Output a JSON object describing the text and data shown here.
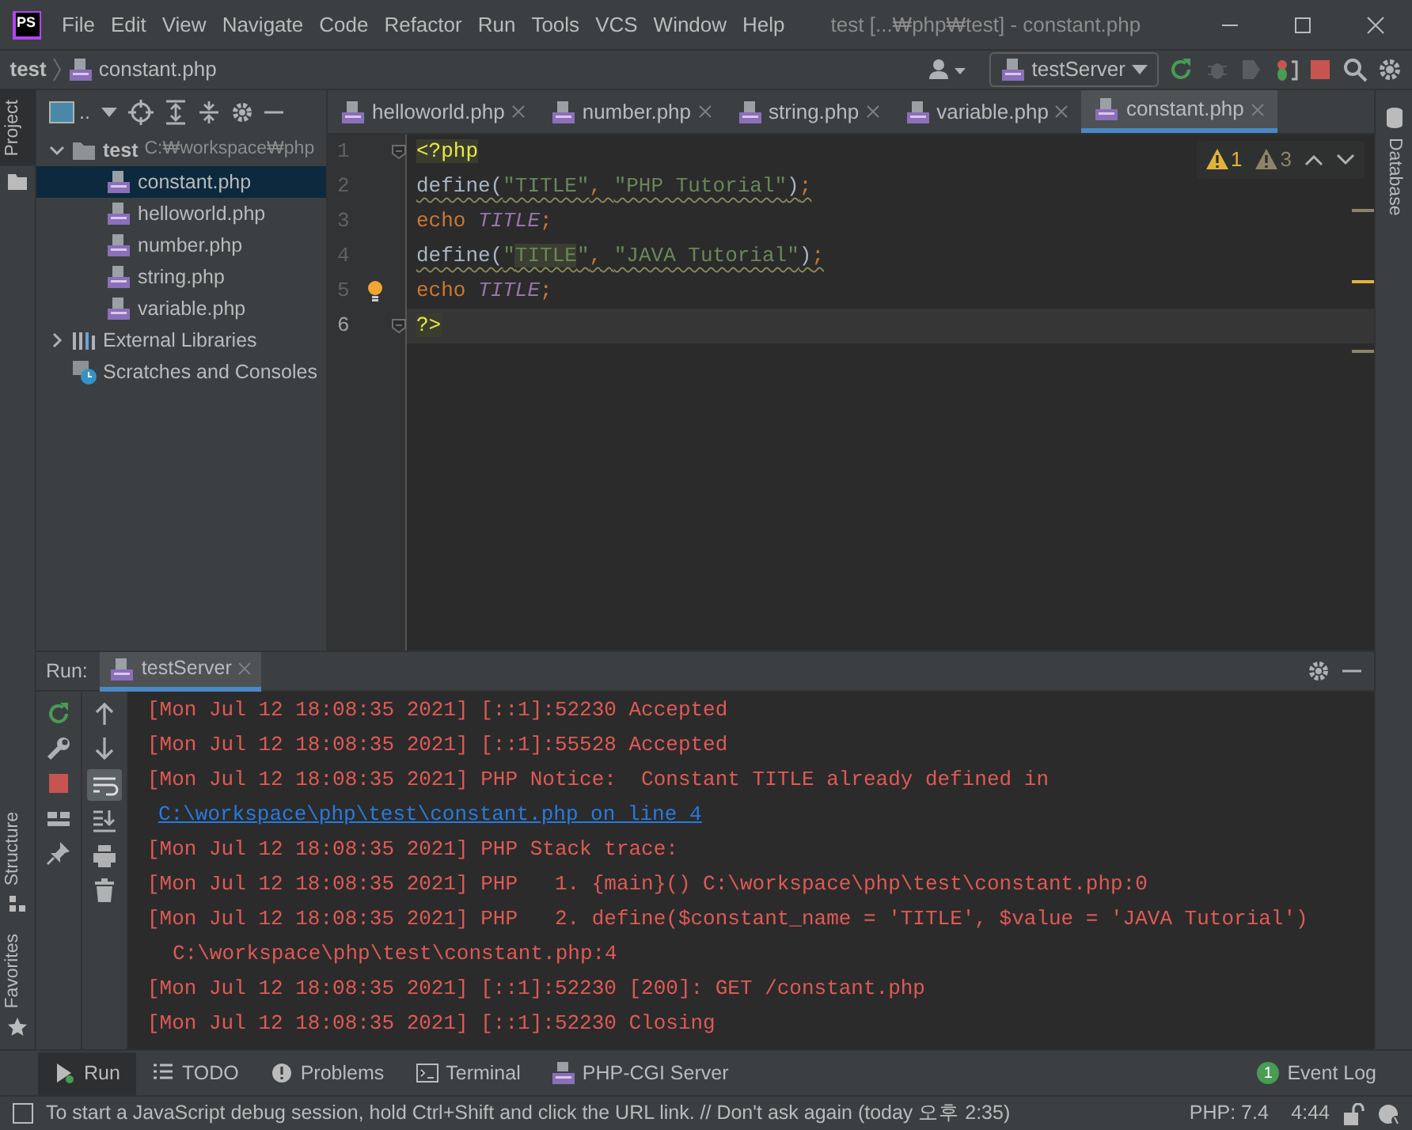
{
  "window": {
    "app_badge": "PS",
    "title": "test [...₩php₩test] - constant.php"
  },
  "menu": [
    "File",
    "Edit",
    "View",
    "Navigate",
    "Code",
    "Refactor",
    "Run",
    "Tools",
    "VCS",
    "Window",
    "Help"
  ],
  "breadcrumb": [
    {
      "label": "test",
      "kind": "folder"
    },
    {
      "label": "constant.php",
      "kind": "file"
    }
  ],
  "run_config": {
    "label": "testServer"
  },
  "left_stripe": [
    {
      "label": "Project",
      "selected": true
    },
    {
      "label": "Structure",
      "selected": false
    },
    {
      "label": "Favorites",
      "selected": false
    }
  ],
  "right_stripe": [
    {
      "label": "Database"
    }
  ],
  "project_panel": {
    "view_label": "..",
    "tree": [
      {
        "label": "test",
        "path": "C:₩workspace₩php",
        "kind": "folder",
        "expanded": true,
        "children": [
          {
            "label": "constant.php",
            "kind": "php",
            "selected": true
          },
          {
            "label": "helloworld.php",
            "kind": "php",
            "selected": false
          },
          {
            "label": "number.php",
            "kind": "php",
            "selected": false
          },
          {
            "label": "string.php",
            "kind": "php",
            "selected": false
          },
          {
            "label": "variable.php",
            "kind": "php",
            "selected": false
          }
        ]
      },
      {
        "label": "External Libraries",
        "kind": "libraries",
        "expanded": false
      },
      {
        "label": "Scratches and Consoles",
        "kind": "scratches"
      }
    ]
  },
  "editor_tabs": [
    {
      "label": "helloworld.php",
      "selected": false
    },
    {
      "label": "number.php",
      "selected": false
    },
    {
      "label": "string.php",
      "selected": false
    },
    {
      "label": "variable.php",
      "selected": false
    },
    {
      "label": "constant.php",
      "selected": true
    }
  ],
  "inspections": [
    {
      "kind": "warning",
      "count": "1"
    },
    {
      "kind": "weak_warning",
      "count": "3"
    }
  ],
  "code_lines": [
    {
      "number": "1",
      "current": false,
      "fold": true,
      "tokens": [
        {
          "kind": "tag",
          "text": "<?php"
        }
      ]
    },
    {
      "number": "2",
      "current": false,
      "fold": false,
      "tokens": [
        {
          "kind": "function",
          "text": "define("
        },
        {
          "kind": "string",
          "text": "\"TITLE\""
        },
        {
          "kind": "punct",
          "text": ", "
        },
        {
          "kind": "string",
          "text": "\"PHP Tutorial\""
        },
        {
          "kind": "function",
          "text": ")"
        },
        {
          "kind": "punct",
          "text": ";"
        }
      ]
    },
    {
      "number": "3",
      "current": false,
      "fold": false,
      "tokens": [
        {
          "kind": "keyword",
          "text": "echo "
        },
        {
          "kind": "constant",
          "text": "TITLE"
        },
        {
          "kind": "punct",
          "text": ";"
        }
      ]
    },
    {
      "number": "4",
      "current": false,
      "fold": false,
      "tokens": [
        {
          "kind": "function",
          "text": "define("
        },
        {
          "kind": "string",
          "text": "\""
        },
        {
          "kind": "highlight",
          "text": "TITLE"
        },
        {
          "kind": "string",
          "text": "\""
        },
        {
          "kind": "punct",
          "text": ", "
        },
        {
          "kind": "string",
          "text": "\"JAVA Tutorial\""
        },
        {
          "kind": "function",
          "text": ")"
        },
        {
          "kind": "punct",
          "text": ";"
        }
      ]
    },
    {
      "number": "5",
      "current": false,
      "fold": false,
      "tokens": [
        {
          "kind": "keyword",
          "text": "echo "
        },
        {
          "kind": "constant",
          "text": "TITLE"
        },
        {
          "kind": "punct",
          "text": ";"
        }
      ]
    },
    {
      "number": "6",
      "current": true,
      "fold": true,
      "tokens": [
        {
          "kind": "tag",
          "text": "?>"
        }
      ]
    }
  ],
  "run_panel": {
    "label": "Run:",
    "tabs": [
      {
        "label": "testServer",
        "selected": true
      }
    ],
    "console": [
      {
        "kind": "error",
        "text": "[Mon Jul 12 18:08:35 2021] [::1]:52230 Accepted"
      },
      {
        "kind": "error",
        "text": "[Mon Jul 12 18:08:35 2021] [::1]:55528 Accepted"
      },
      {
        "kind": "error",
        "text": "[Mon Jul 12 18:08:35 2021] PHP Notice:  Constant TITLE already defined in"
      },
      {
        "kind": "link",
        "text": "C:\\workspace\\php\\test\\constant.php on line 4"
      },
      {
        "kind": "error",
        "text": "[Mon Jul 12 18:08:35 2021] PHP Stack trace:"
      },
      {
        "kind": "error",
        "text": "[Mon Jul 12 18:08:35 2021] PHP   1. {main}() C:\\workspace\\php\\test\\constant.php:0"
      },
      {
        "kind": "error",
        "text": "[Mon Jul 12 18:08:35 2021] PHP   2. define($constant_name = 'TITLE', $value = 'JAVA Tutorial')"
      },
      {
        "kind": "continuation",
        "text": "C:\\workspace\\php\\test\\constant.php:4"
      },
      {
        "kind": "error",
        "text": "[Mon Jul 12 18:08:35 2021] [::1]:52230 [200]: GET /constant.php"
      },
      {
        "kind": "error",
        "text": "[Mon Jul 12 18:08:35 2021] [::1]:52230 Closing"
      }
    ]
  },
  "tool_buttons": [
    {
      "label": "Run",
      "kind": "run",
      "selected": true
    },
    {
      "label": "TODO",
      "kind": "todo",
      "selected": false
    },
    {
      "label": "Problems",
      "kind": "problems",
      "selected": false
    },
    {
      "label": "Terminal",
      "kind": "terminal",
      "selected": false
    },
    {
      "label": "PHP-CGI Server",
      "kind": "php",
      "selected": false
    }
  ],
  "event_log": {
    "label": "Event Log",
    "badge": "1"
  },
  "status_bar": {
    "message": "To start a JavaScript debug session, hold Ctrl+Shift and click the URL link. // Don't ask again (today 오후 2:35)",
    "php_version": "PHP: 7.4",
    "position": "4:44"
  }
}
